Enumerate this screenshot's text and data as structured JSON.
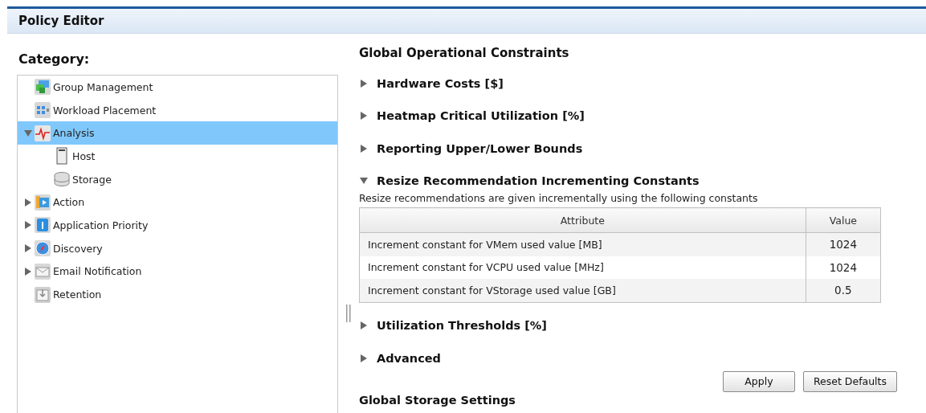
{
  "window": {
    "title": "Policy Editor"
  },
  "sidebar": {
    "title": "Category:",
    "items": [
      {
        "label": "Group Management",
        "selected": false
      },
      {
        "label": "Workload Placement",
        "selected": false
      },
      {
        "label": "Analysis",
        "selected": true,
        "expanded": true,
        "children": [
          {
            "label": "Host",
            "selected": false
          },
          {
            "label": "Storage",
            "selected": false
          }
        ]
      },
      {
        "label": "Action",
        "selected": false,
        "expanded": false
      },
      {
        "label": "Application Priority",
        "selected": false,
        "expanded": false
      },
      {
        "label": "Discovery",
        "selected": false,
        "expanded": false
      },
      {
        "label": "Email Notification",
        "selected": false,
        "expanded": false
      },
      {
        "label": "Retention",
        "selected": false
      }
    ]
  },
  "main": {
    "title": "Global Operational Constraints",
    "sections": [
      {
        "title": "Hardware Costs [$]",
        "expanded": false
      },
      {
        "title": "Heatmap Critical Utilization [%]",
        "expanded": false
      },
      {
        "title": "Reporting Upper/Lower Bounds",
        "expanded": false
      },
      {
        "title": "Resize Recommendation Incrementing Constants",
        "expanded": true,
        "description": "Resize recommendations are given incrementally using the following constants",
        "table": {
          "columns": [
            "Attribute",
            "Value"
          ],
          "rows": [
            [
              "Increment constant for VMem used value [MB]",
              "1024"
            ],
            [
              "Increment constant for VCPU used value [MHz]",
              "1024"
            ],
            [
              "Increment constant for VStorage used value [GB]",
              "0.5"
            ]
          ]
        }
      },
      {
        "title": "Utilization Thresholds [%]",
        "expanded": false
      },
      {
        "title": "Advanced",
        "expanded": false
      }
    ],
    "buttons": [
      "Apply",
      "Reset Defaults"
    ],
    "next_title": "Global Storage Settings"
  }
}
